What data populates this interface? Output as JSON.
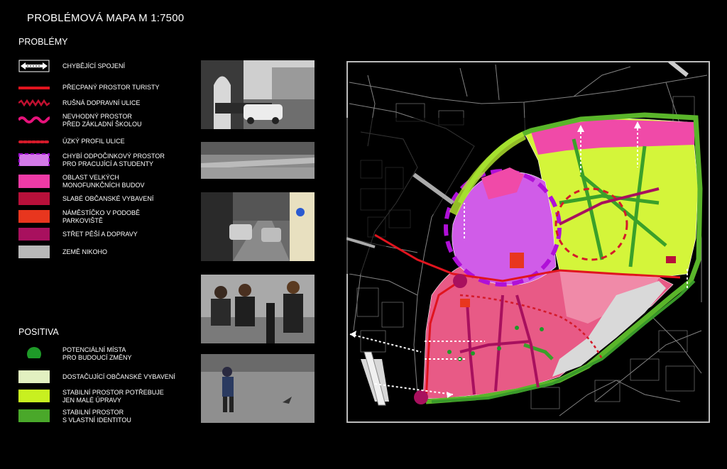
{
  "title": "PROBLÉMOVÁ MAPA M 1:7500",
  "problems_heading": "PROBLÉMY",
  "positives_heading": "POSITIVA",
  "problems": [
    {
      "label": "CHYBĚJÍCÍ SPOJENÍ",
      "icon": "missing-connection-arrow-icon",
      "color": "#ffffff"
    },
    {
      "label": "PŘECPANÝ PROSTOR TURISTY",
      "icon": "red-line-icon",
      "color": "#e0141e"
    },
    {
      "label": "RUŠNÁ DOPRAVNÍ ULICE",
      "icon": "zigzag-line-icon",
      "color": "#c01030"
    },
    {
      "label": "NEVHODNÝ PROSTOR\nPŘED ZÁKLADNÍ ŠKOLOU",
      "icon": "wavy-line-icon",
      "color": "#e6127a"
    },
    {
      "label": "ÚZKÝ PROFIL ULICE",
      "icon": "dotted-line-icon",
      "color": "#d41a2a"
    },
    {
      "label": "CHYBÍ ODPOČINKOVÝ PROSTOR\nPRO PRACUJÍCÍ A STUDENTY",
      "icon": "dashed-circle-area-icon",
      "color": "#c040e0"
    },
    {
      "label": "OBLAST VELKÝCH\nMONOFUNKČNÍCH BUDOV",
      "icon": "pink-area-icon",
      "color": "#ee3aa6"
    },
    {
      "label": "SLABÉ OBČANSKÉ VYBAVENÍ",
      "icon": "crimson-area-icon",
      "color": "#b8103a"
    },
    {
      "label": "NÁMĚSTÍČKO V PODOBĚ\nPARKOVIŠTĚ",
      "icon": "orange-red-area-icon",
      "color": "#e8361e"
    },
    {
      "label": "STŘET PĚŠÍ A DOPRAVY",
      "icon": "magenta-area-icon",
      "color": "#a8105e"
    },
    {
      "label": "ZEMĚ NIKOHO",
      "icon": "grey-area-icon",
      "color": "#b8b8b8"
    }
  ],
  "positives": [
    {
      "label": "POTENCIÁLNÍ MÍSTA\nPRO BUDOUCÍ ZMĚNY",
      "icon": "green-dot-icon",
      "color": "#1e9a28"
    },
    {
      "label": "DOSTAČUJÍCÍ OBČANSKÉ VYBAVENÍ",
      "icon": "pale-green-area-icon",
      "color": "#e2f0c0"
    },
    {
      "label": "STABILNÍ PROSTOR POTŘEBUJE\nJEN MALÉ ÚPRAVY",
      "icon": "lime-area-icon",
      "color": "#c8f020"
    },
    {
      "label": "STABILNÍ PROSTOR\nS VLASTNÍ IDENTITOU",
      "icon": "green-area-icon",
      "color": "#4aa82a"
    }
  ]
}
